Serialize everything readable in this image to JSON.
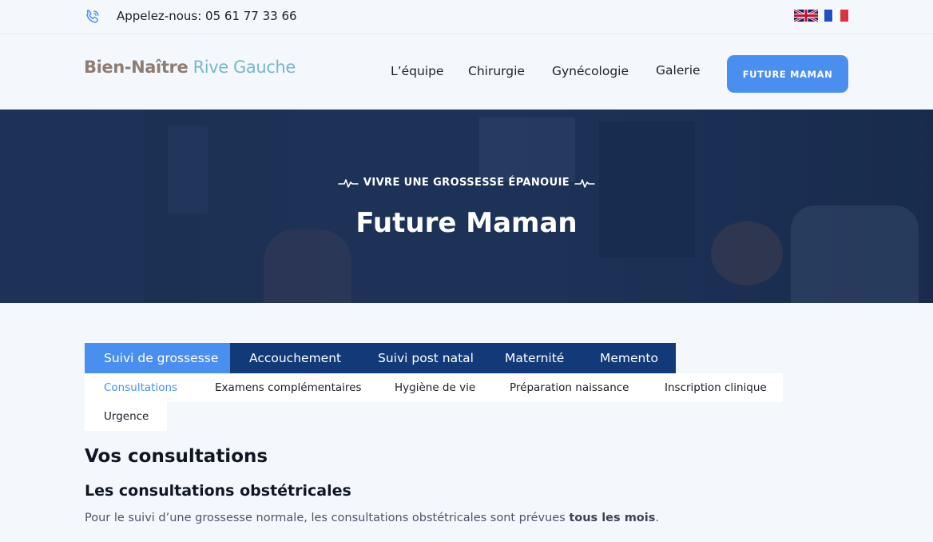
{
  "topbar": {
    "phone_icon": "phone-icon",
    "phone_text": "Appelez-nous: 05 61 77 33 66",
    "languages": [
      {
        "code": "en",
        "icon": "uk-flag-icon"
      },
      {
        "code": "fr",
        "icon": "fr-flag-icon"
      }
    ]
  },
  "header": {
    "logo_part1": "Bien-Naître",
    "logo_part2": " Rive Gauche",
    "nav": [
      "L’équipe",
      "Chirurgie",
      "Gynécologie",
      "Galerie"
    ],
    "cta": "FUTURE MAMAN"
  },
  "hero": {
    "eyebrow": "VIVRE UNE GROSSESSE ÉPANOUIE",
    "title": "Future Maman"
  },
  "tabs": {
    "items": [
      "Suivi de grossesse",
      "Accouchement",
      "Suivi post natal",
      "Maternité",
      "Memento"
    ],
    "active": "Suivi de grossesse"
  },
  "subtabs": {
    "items": [
      "Consultations",
      "Examens complémentaires",
      "Hygiène de vie",
      "Préparation naissance",
      "Inscription clinique",
      "Urgence"
    ],
    "active": "Consultations"
  },
  "content": {
    "heading": "Vos consultations",
    "subheading": "Les consultations obstétricales",
    "paragraph_start": "Pour le suivi d’une grossesse normale, les consultations obstétricales sont prévues ",
    "paragraph_bold": "tous les mois",
    "paragraph_end": "."
  },
  "colors": {
    "accent": "#4a8ff0",
    "tab_dark": "#123a78",
    "background": "#f4f8fd"
  }
}
